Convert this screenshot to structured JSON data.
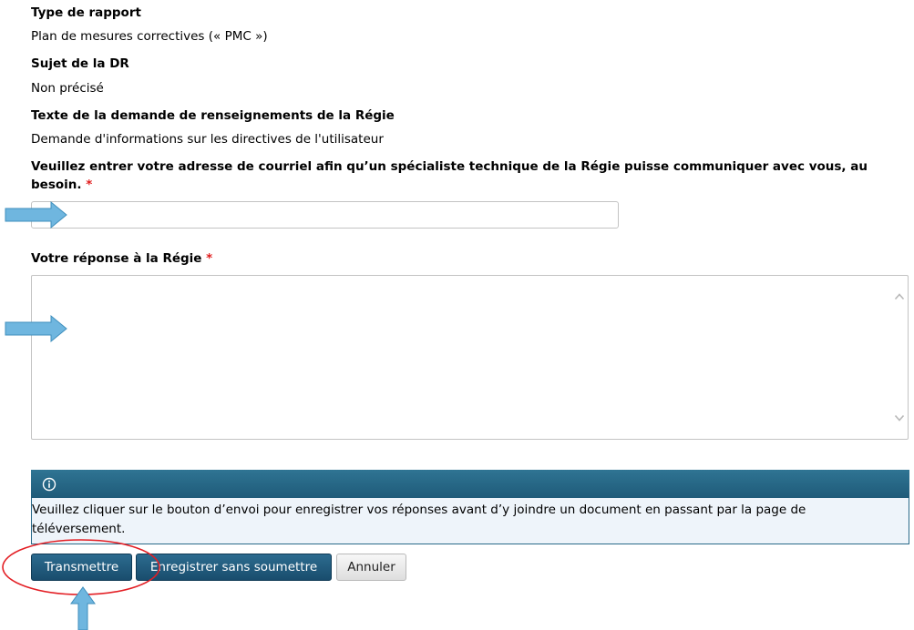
{
  "fields": {
    "type_rapport": {
      "label": "Type de rapport",
      "value": "Plan de mesures correctives (« PMC »)"
    },
    "sujet_dr": {
      "label": "Sujet de la DR",
      "value": "Non précisé"
    },
    "texte_demande": {
      "label": "Texte de la demande de renseignements de la Régie",
      "value": "Demande d'informations sur les directives de l'utilisateur"
    }
  },
  "email": {
    "label": "Veuillez entrer votre adresse de courriel afin qu’un spécialiste technique de la Régie puisse communiquer avec vous, au besoin.",
    "required_marker": "*",
    "value": ""
  },
  "reponse": {
    "label": "Votre réponse à la Régie",
    "required_marker": "*",
    "value": ""
  },
  "info_box": {
    "icon": "info-icon",
    "message": "Veuillez cliquer sur le bouton d’envoi pour enregistrer vos réponses avant d’y joindre un document en passant par la page de téléversement."
  },
  "buttons": {
    "submit": "Transmettre",
    "save": "Enregistrer sans soumettre",
    "cancel": "Annuler"
  },
  "annotations": {
    "arrow_color": "#6fb6df",
    "highlight_color": "#e31e24"
  },
  "colors": {
    "primary_button": "#1f5a7c",
    "info_header": "#2a6a89",
    "info_body": "#eef4fa",
    "required": "#e01b1b"
  }
}
